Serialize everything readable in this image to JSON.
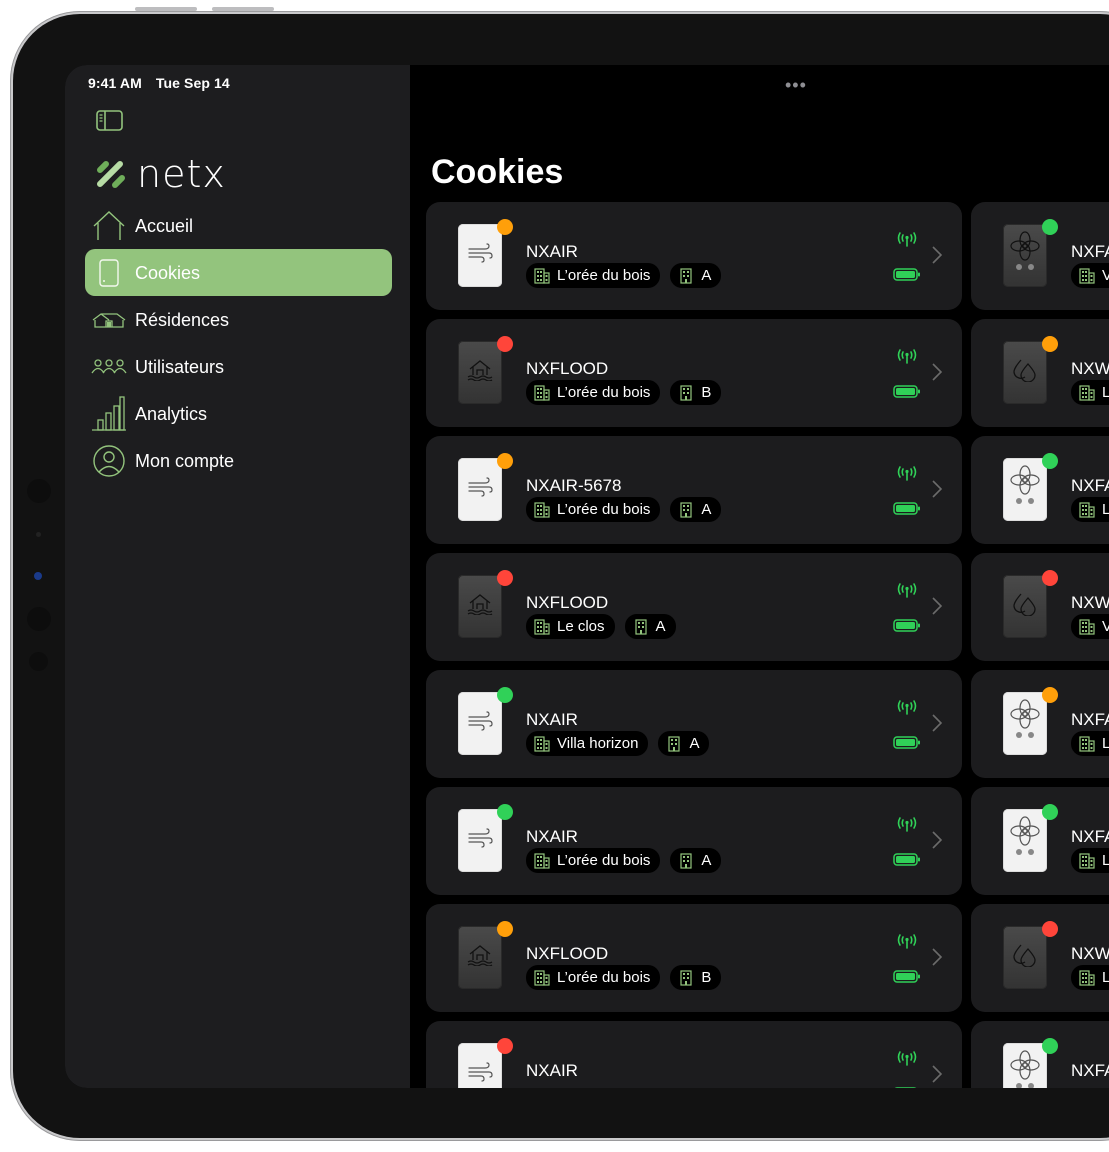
{
  "status_bar": {
    "time": "9:41 AM",
    "date": "Tue Sep 14"
  },
  "brand": {
    "name": "netx",
    "accent": "#93c47d"
  },
  "sidebar": {
    "toggle_icon": "sidebar-toggle-icon",
    "items": [
      {
        "label": "Accueil",
        "icon": "home-icon",
        "active": false
      },
      {
        "label": "Cookies",
        "icon": "device-icon",
        "active": true
      },
      {
        "label": "Résidences",
        "icon": "residences-icon",
        "active": false
      },
      {
        "label": "Utilisateurs",
        "icon": "users-icon",
        "active": false
      },
      {
        "label": "Analytics",
        "icon": "chart-icon",
        "active": false
      },
      {
        "label": "Mon compte",
        "icon": "account-icon",
        "active": false
      }
    ]
  },
  "main": {
    "title": "Cookies",
    "more_icon": "•••",
    "status_colors": {
      "ok": "#30d158",
      "warning": "#ff9f0a",
      "error": "#ff453a"
    },
    "cards_left": [
      {
        "name": "NXAIR",
        "type": "air",
        "finish": "light",
        "status": "warning",
        "residence": "L’orée du bois",
        "building": "A"
      },
      {
        "name": "NXFLOOD",
        "type": "flood",
        "finish": "dark",
        "status": "error",
        "residence": "L’orée du bois",
        "building": "B"
      },
      {
        "name": "NXAIR-5678",
        "type": "air",
        "finish": "light",
        "status": "warning",
        "residence": "L’orée du bois",
        "building": "A"
      },
      {
        "name": "NXFLOOD",
        "type": "flood",
        "finish": "dark",
        "status": "error",
        "residence": "Le clos",
        "building": "A"
      },
      {
        "name": "NXAIR",
        "type": "air",
        "finish": "light",
        "status": "ok",
        "residence": "Villa horizon",
        "building": "A"
      },
      {
        "name": "NXAIR",
        "type": "air",
        "finish": "light",
        "status": "ok",
        "residence": "L’orée du bois",
        "building": "A"
      },
      {
        "name": "NXFLOOD",
        "type": "flood",
        "finish": "dark",
        "status": "warning",
        "residence": "L’orée du bois",
        "building": "B"
      },
      {
        "name": "NXAIR",
        "type": "air",
        "finish": "light",
        "status": "error",
        "residence": "",
        "building": ""
      }
    ],
    "cards_right": [
      {
        "name": "NXFA",
        "type": "fan",
        "finish": "dark",
        "status": "ok",
        "residence": "V"
      },
      {
        "name": "NXW",
        "type": "water",
        "finish": "dark",
        "status": "warning",
        "residence": "L’"
      },
      {
        "name": "NXFA",
        "type": "fan",
        "finish": "light",
        "status": "ok",
        "residence": "L"
      },
      {
        "name": "NXW",
        "type": "water",
        "finish": "dark",
        "status": "error",
        "residence": "V"
      },
      {
        "name": "NXFA",
        "type": "fan",
        "finish": "light",
        "status": "warning",
        "residence": "L"
      },
      {
        "name": "NXFA",
        "type": "fan",
        "finish": "light",
        "status": "ok",
        "residence": "L"
      },
      {
        "name": "NXW",
        "type": "water",
        "finish": "dark",
        "status": "error",
        "residence": "L"
      },
      {
        "name": "NXFA",
        "type": "fan",
        "finish": "light",
        "status": "ok",
        "residence": ""
      }
    ]
  }
}
